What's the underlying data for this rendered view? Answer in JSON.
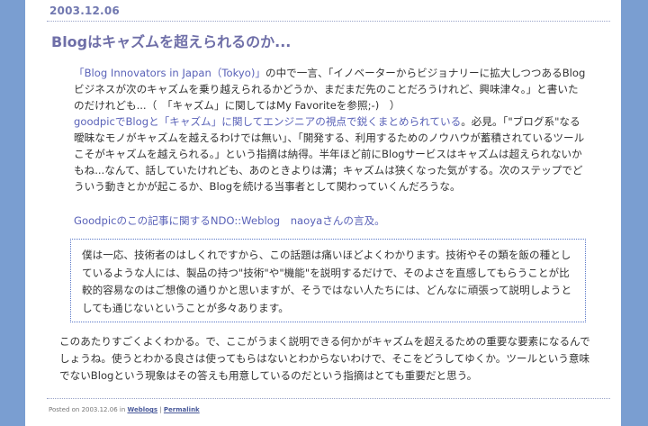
{
  "post": {
    "date": "2003.12.06",
    "title": "Blogはキャズムを超えられるのか...",
    "p1": {
      "link1": "「Blog Innovators in Japan（Tokyo)」",
      "text1": "の中で一言、「イノベーターからビジョナリーに拡大しつつあるBlogビジネスが次のキャズムを乗り越えられるかどうか、まだまだ先のことだろうけれど、興味津々。」と書いたのだけれども...（　「キャズム」に関してはMy Favoriteを参照;-)　）"
    },
    "p2": {
      "link1": "goodpicでBlogと「キャズム」に関してエンジニアの視点で鋭くまとめられている",
      "text1": "。必見。「\"ブログ系\"なる曖昧なモノがキャズムを越えるわけでは無い」、「開発する、利用するためのノウハウが蓄積されているツールこそがキャズムを越えられる。」という指摘は納得。半年ほど前にBlogサービスはキャズムは超えられないかもね...なんて、話していたけれども、あのときよりは溝；キャズムは狭くなった気がする。次のステップでどういう動きとかが起こるか、Blogを続ける当事者として関わっていくんだろうな。"
    },
    "p3_link": "Goodpicのこの記事に関するNDO::Weblog　naoyaさんの言及。",
    "quote": "僕は一応、技術者のはしくれですから、この話題は痛いほどよくわかります。技術やその類を飯の種としているような人には、製品の持つ\"技術\"や\"機能\"を説明するだけで、そのよさを直感してもらうことが比較的容易なのはご想像の通りかと思いますが、そうではない人たちには、どんなに頑張って説明しようとしても通じないということが多々あります。",
    "p4": "このあたりすごくよくわかる。で、ここがうまく説明できる何かがキャズムを超えるための重要な要素になるんでしょうね。使うとわかる良さは使ってもらはないとわからないわけで、そこをどうしてゆくか。ツールという意味でないBlogという現象はその答えも用意しているのだという指摘はとても重要だと思う。",
    "footer": {
      "posted_prefix": "Posted on 2003.12.06 in ",
      "category": "Weblogs",
      "separator": " | ",
      "permalink": "Permalink"
    }
  }
}
